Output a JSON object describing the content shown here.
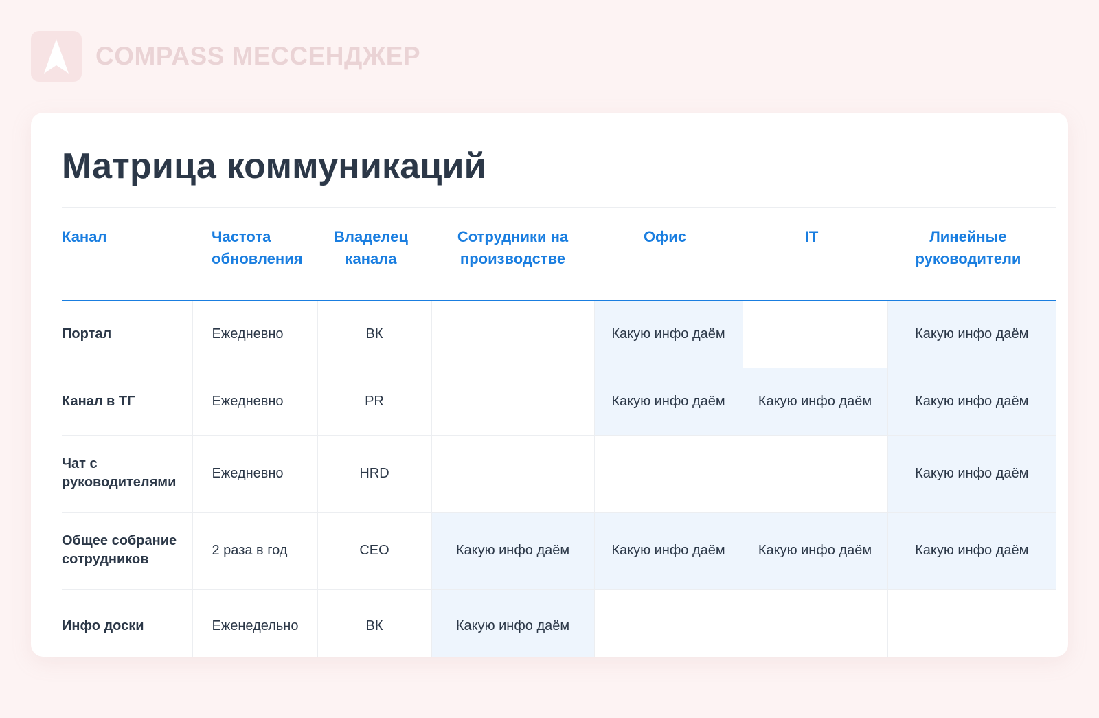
{
  "brand": {
    "name": "COMPASS МЕССЕНДЖЕР",
    "logo_icon": "compass-a-logo-icon",
    "colors": {
      "background": "#fdf3f3",
      "logo_tile": "#f7e3e4",
      "logo_text": "#ead3d5"
    }
  },
  "page": {
    "title": "Матрица коммуникаций",
    "colors": {
      "title": "#2c3848",
      "header_text": "#1a7ee0",
      "filled_cell": "#eef5fd"
    }
  },
  "table": {
    "columns": [
      "Канал",
      "Частота обновления",
      "Владелец канала",
      "Сотрудники на производстве",
      "Офис",
      "IT",
      "Линейные руководители"
    ],
    "rows": [
      [
        "Портал",
        "Ежедневно",
        "ВК",
        "",
        "Какую инфо даём",
        "",
        "Какую инфо даём"
      ],
      [
        "Канал в ТГ",
        "Ежедневно",
        "PR",
        "",
        "Какую инфо даём",
        "Какую инфо даём",
        "Какую инфо даём"
      ],
      [
        "Чат с руководителями",
        "Ежедневно",
        "HRD",
        "",
        "",
        "",
        "Какую инфо даём"
      ],
      [
        "Общее собрание сотрудников",
        "2 раза в год",
        "CEO",
        "Какую инфо даём",
        "Какую инфо даём",
        "Какую инфо даём",
        "Какую инфо даём"
      ],
      [
        "Инфо доски",
        "Еженедельно",
        "ВК",
        "Какую инфо даём",
        "",
        "",
        ""
      ]
    ]
  }
}
